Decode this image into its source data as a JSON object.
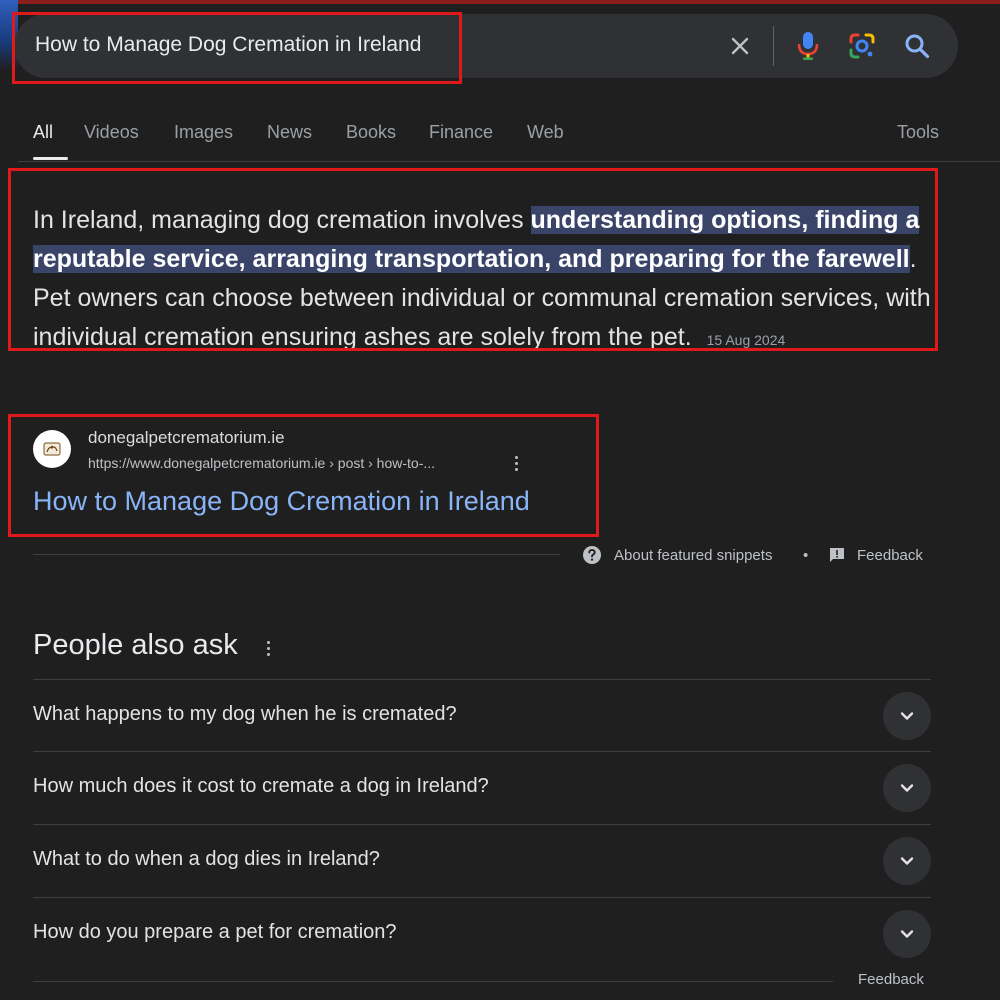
{
  "search": {
    "query": "How to Manage Dog Cremation in Ireland"
  },
  "tabs": [
    "All",
    "Videos",
    "Images",
    "News",
    "Books",
    "Finance",
    "Web"
  ],
  "tools_label": "Tools",
  "snippet": {
    "text_before": "In Ireland, managing dog cremation involves ",
    "highlight": "understanding options, finding a reputable service, arranging transportation, and preparing for the farewell",
    "text_after": ". Pet owners can choose between individual or communal cremation services, with individual cremation ensuring ashes are solely from the pet.",
    "date": "15 Aug 2024"
  },
  "source": {
    "site_name": "donegalpetcrematorium.ie",
    "url": "https://www.donegalpetcrematorium.ie › post › how-to-...",
    "title": "How to Manage Dog Cremation in Ireland"
  },
  "snippet_footer": {
    "about_label": "About featured snippets",
    "separator": "•",
    "feedback_label": "Feedback"
  },
  "people_also_ask": {
    "title": "People also ask",
    "questions": [
      "What happens to my dog when he is cremated?",
      "How much does it cost to cremate a dog in Ireland?",
      "What to do when a dog dies in Ireland?",
      "How do you prepare a pet for cremation?"
    ],
    "feedback_label": "Feedback"
  },
  "icons": {
    "clear": "close-icon",
    "voice": "microphone-icon",
    "lens": "google-lens-icon",
    "search": "search-icon",
    "help": "help-circle-icon",
    "feedback": "feedback-icon",
    "more": "more-vert-icon",
    "expand": "chevron-down-icon"
  },
  "colors": {
    "background": "#1f1f1f",
    "search_bar": "#303134",
    "link": "#8ab4f8",
    "highlight": "#394468",
    "annotation": "#e01a1a"
  }
}
